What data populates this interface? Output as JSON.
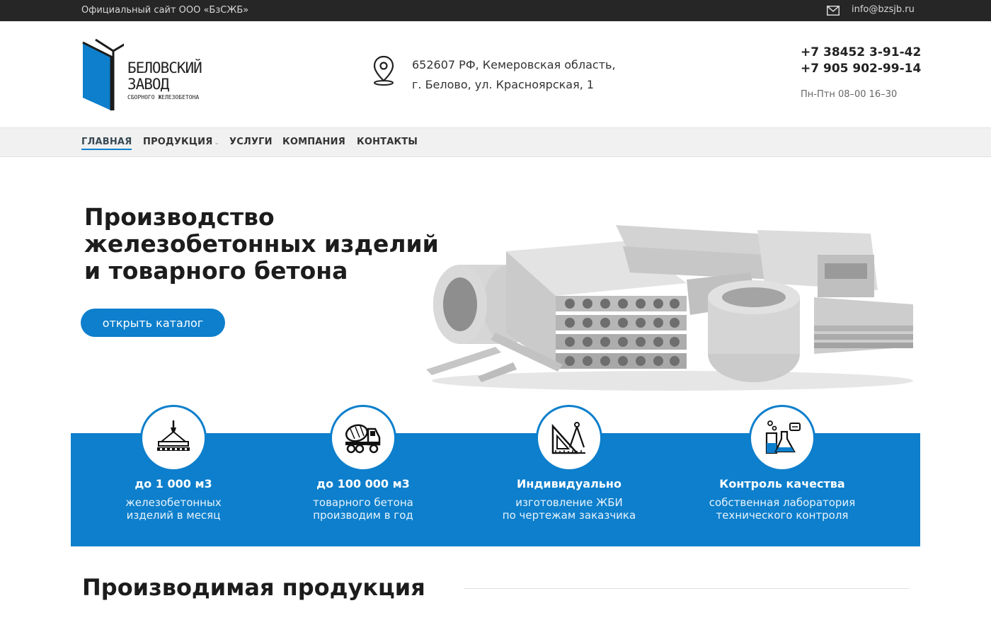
{
  "topbar": {
    "site_label": "Официальный сайт ООО «БзСЖБ»",
    "email": "info@bzsjb.ru",
    "email_icon": "envelope-icon"
  },
  "logo": {
    "line1": "БЕЛОВСКИЙ",
    "line2": "ЗАВОД",
    "line3": "СБОРНОГО ЖЕЛЕЗОБЕТОНА",
    "accent_color": "#0d7fcc"
  },
  "address": {
    "icon": "map-pin-icon",
    "line1": "652607 РФ, Кемеровская область,",
    "line2": "г. Белово, ул. Красноярская, 1"
  },
  "contacts": {
    "phone1": "+7 38452 3-91-42",
    "phone2": "+7 905 902-99-14",
    "hours": "Пн-Птн 08–00 16–30"
  },
  "nav": {
    "items": [
      {
        "label": "ГЛАВНАЯ",
        "active": true
      },
      {
        "label": "ПРОДУКЦИЯ",
        "has_dropdown": true
      },
      {
        "label": "УСЛУГИ"
      },
      {
        "label": "КОМПАНИЯ"
      },
      {
        "label": "КОНТАКТЫ"
      }
    ],
    "dropdown_icon": "chevron-down-icon"
  },
  "hero": {
    "title_line1": "Производство",
    "title_line2": "железобетонных изделий",
    "title_line3": "и товарного бетона",
    "button_label": "открыть каталог"
  },
  "features": [
    {
      "icon": "crane-slab-icon",
      "title": "до 1 000 м3",
      "desc_line1": "железобетонных",
      "desc_line2": "изделий в месяц"
    },
    {
      "icon": "concrete-mixer-truck-icon",
      "title": "до 100 000 м3",
      "desc_line1": "товарного бетона",
      "desc_line2": "производим в год"
    },
    {
      "icon": "drafting-tools-icon",
      "title": "Индивидуально",
      "desc_line1": "изготовление ЖБИ",
      "desc_line2": "по чертежам заказчика"
    },
    {
      "icon": "lab-flask-icon",
      "title": "Контроль качества",
      "desc_line1": "собственная лаборатория",
      "desc_line2": "технического контроля"
    }
  ],
  "colors": {
    "accent": "#0d7fcc",
    "topbar_bg": "#262626",
    "nav_bg": "#f1f1f1"
  },
  "products": {
    "heading": "Производимая продукция"
  }
}
